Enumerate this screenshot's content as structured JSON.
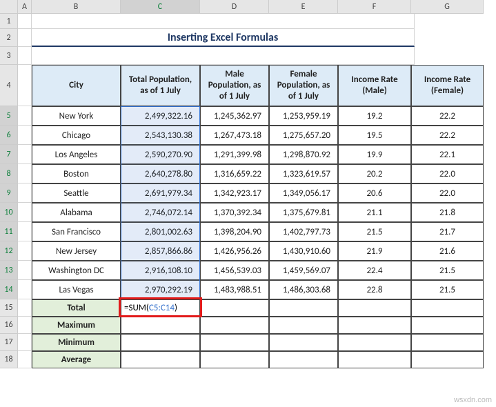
{
  "columns": [
    "A",
    "B",
    "C",
    "D",
    "E",
    "F",
    "G"
  ],
  "selected_column": "C",
  "selected_rows": [
    "5",
    "6",
    "7",
    "8",
    "9",
    "10",
    "11",
    "12",
    "13",
    "14"
  ],
  "title": "Inserting Excel Formulas",
  "headers": {
    "city": "City",
    "total_pop": "Total Population, as of 1 July",
    "male_pop": "Male Population, as of 1 July",
    "female_pop": "Female Population, as of 1 July",
    "income_male": "Income Rate (Male)",
    "income_female": "Income Rate (Female)"
  },
  "rows": [
    {
      "city": "New York",
      "total": "2,499,322.16",
      "male": "1,245,362.97",
      "female": "1,253,959.19",
      "im": "19.2",
      "if": "22.2"
    },
    {
      "city": "Chicago",
      "total": "2,543,130.38",
      "male": "1,267,473.18",
      "female": "1,275,657.20",
      "im": "19.5",
      "if": "22.2"
    },
    {
      "city": "Los Angeles",
      "total": "2,590,270.90",
      "male": "1,291,399.98",
      "female": "1,298,870.92",
      "im": "19.9",
      "if": "22.1"
    },
    {
      "city": "Boston",
      "total": "2,640,278.80",
      "male": "1,316,659.22",
      "female": "1,323,619.57",
      "im": "20.2",
      "if": "22.0"
    },
    {
      "city": "Seattle",
      "total": "2,691,979.34",
      "male": "1,342,923.17",
      "female": "1,349,056.17",
      "im": "20.6",
      "if": "22.0"
    },
    {
      "city": "Alabama",
      "total": "2,746,072.14",
      "male": "1,370,392.34",
      "female": "1,375,679.81",
      "im": "21.1",
      "if": "21.8"
    },
    {
      "city": "San Francisco",
      "total": "2,801,002.63",
      "male": "1,398,204.90",
      "female": "1,402,797.73",
      "im": "21.5",
      "if": "21.7"
    },
    {
      "city": "New Jersey",
      "total": "2,857,866.86",
      "male": "1,426,956.26",
      "female": "1,430,910.60",
      "im": "21.9",
      "if": "21.6"
    },
    {
      "city": "Washington DC",
      "total": "2,916,108.10",
      "male": "1,456,539.03",
      "female": "1,459,569.07",
      "im": "22.4",
      "if": "21.5"
    },
    {
      "city": "Las Vegas",
      "total": "2,970,292.19",
      "male": "1,483,988.51",
      "female": "1,486,303.68",
      "im": "22.8",
      "if": "21.5"
    }
  ],
  "summary_labels": {
    "total": "Total",
    "max": "Maximum",
    "min": "Minimum",
    "avg": "Average"
  },
  "formula": {
    "eq": "=",
    "fn": "SUM",
    "open": "(",
    "ref": "C5:C14",
    "close": ")"
  },
  "chart_data": {
    "type": "table",
    "title": "Inserting Excel Formulas",
    "columns": [
      "City",
      "Total Population, as of 1 July",
      "Male Population, as of 1 July",
      "Female Population, as of 1 July",
      "Income Rate (Male)",
      "Income Rate (Female)"
    ],
    "data": [
      [
        "New York",
        2499322.16,
        1245362.97,
        1253959.19,
        19.2,
        22.2
      ],
      [
        "Chicago",
        2543130.38,
        1267473.18,
        1275657.2,
        19.5,
        22.2
      ],
      [
        "Los Angeles",
        2590270.9,
        1291399.98,
        1298870.92,
        19.9,
        22.1
      ],
      [
        "Boston",
        2640278.8,
        1316659.22,
        1323619.57,
        20.2,
        22.0
      ],
      [
        "Seattle",
        2691979.34,
        1342923.17,
        1349056.17,
        20.6,
        22.0
      ],
      [
        "Alabama",
        2746072.14,
        1370392.34,
        1375679.81,
        21.1,
        21.8
      ],
      [
        "San Francisco",
        2801002.63,
        1398204.9,
        1402797.73,
        21.5,
        21.7
      ],
      [
        "New Jersey",
        2857866.86,
        1426956.26,
        1430910.6,
        21.9,
        21.6
      ],
      [
        "Washington DC",
        2916108.1,
        1456539.03,
        1459569.07,
        22.4,
        21.5
      ],
      [
        "Las Vegas",
        2970292.19,
        1483988.51,
        1486303.68,
        22.8,
        21.5
      ]
    ]
  },
  "watermark": "wsxdn.com"
}
